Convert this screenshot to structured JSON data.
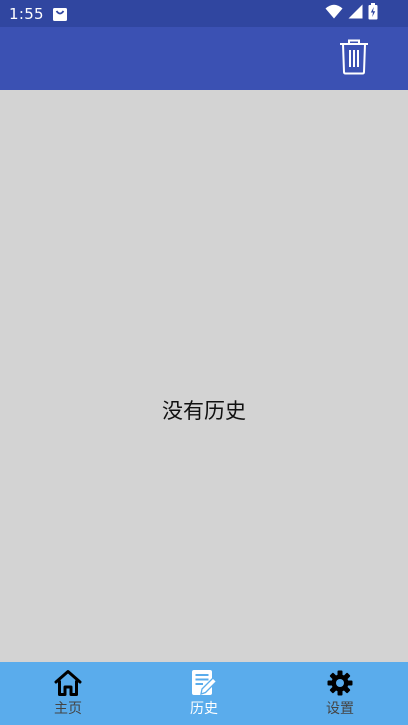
{
  "status_bar": {
    "time": "1:55",
    "icons": [
      "notification-bag-icon",
      "wifi-icon",
      "signal-icon",
      "battery-charging-icon"
    ]
  },
  "app_bar": {
    "action_icon": "trash-icon"
  },
  "content": {
    "empty_message": "没有历史"
  },
  "bottom_nav": {
    "items": [
      {
        "label": "主页",
        "icon": "home-icon",
        "active": false
      },
      {
        "label": "历史",
        "icon": "history-note-icon",
        "active": true
      },
      {
        "label": "设置",
        "icon": "gear-icon",
        "active": false
      }
    ]
  },
  "colors": {
    "status_bar": "#3046a0",
    "app_bar": "#3b51b3",
    "content_bg": "#d3d3d3",
    "bottom_nav": "#5aacec",
    "active_label": "#ffffff"
  }
}
